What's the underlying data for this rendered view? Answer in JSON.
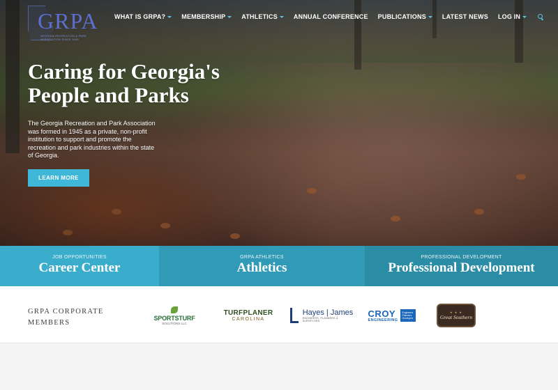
{
  "logo": {
    "mark": "GRPA",
    "tagline": "GEORGIA RECREATION & PARK ASSOCIATION SINCE 1945"
  },
  "nav": {
    "items": [
      {
        "label": "WHAT IS GRPA?",
        "dropdown": true
      },
      {
        "label": "MEMBERSHIP",
        "dropdown": true
      },
      {
        "label": "ATHLETICS",
        "dropdown": true
      },
      {
        "label": "ANNUAL CONFERENCE",
        "dropdown": false
      },
      {
        "label": "PUBLICATIONS",
        "dropdown": true
      },
      {
        "label": "LATEST NEWS",
        "dropdown": false
      },
      {
        "label": "LOG IN",
        "dropdown": true
      }
    ],
    "search_icon": "search-icon"
  },
  "hero": {
    "headline": "Caring for Georgia's People and Parks",
    "intro": "The Georgia Recreation and Park Association was formed in 1945 as a private, non-profit institution to support and promote the recreation and park industries within the state of Georgia.",
    "cta_label": "LEARN MORE"
  },
  "features": [
    {
      "eyebrow": "JOB OPPORTUNITIES",
      "title": "Career Center"
    },
    {
      "eyebrow": "GRPA ATHLETICS",
      "title": "Athletics"
    },
    {
      "eyebrow": "PROFESSIONAL DEVELOPMENT",
      "title": "Professional Development"
    }
  ],
  "members": {
    "label_line1": "GRPA CORPORATE",
    "label_line2": "MEMBERS",
    "sponsors": {
      "sportsturf": {
        "name": "SPORTSTURF",
        "sub": "SOLUTIONS LLC"
      },
      "turfplaner": {
        "name": "TURFPLANER",
        "sub": "CAROLINA"
      },
      "hayes": {
        "name": "Hayes | James",
        "sub": "ENGINEERS, PLANNERS & SURVEYORS"
      },
      "croy": {
        "name": "CROY",
        "sub": "ENGINEERING",
        "box": "Engineers Planners Surveyors"
      },
      "greatsouthern": {
        "name": "Great Southern",
        "stars": "★ ★ ★"
      }
    }
  },
  "colors": {
    "accent": "#3eb7d8",
    "tile1": "#3aaccc",
    "tile2": "#319bb7",
    "tile3": "#2b8ca6",
    "logo": "#5b6fd0"
  }
}
